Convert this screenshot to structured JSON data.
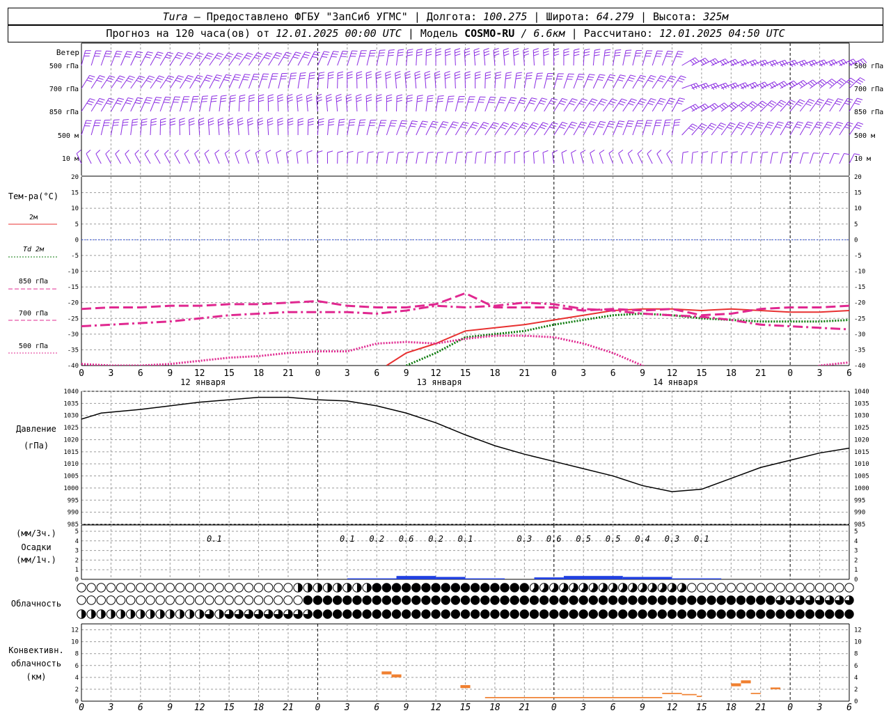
{
  "header": {
    "line1": {
      "station": "Tura",
      "provided_by": "— Предоставлено ФГБУ \"ЗапСиб УГМС\" | Долгота:",
      "lon": "100.275",
      "lat_label": "| Широта:",
      "lat": "64.279",
      "alt_label": "| Высота:",
      "alt": "325м"
    },
    "line2": {
      "forecast": "Прогноз на 120 часа(ов) от",
      "start": "12.01.2025 00:00 UTC",
      "model_label": "| Модель",
      "model": "COSMO-RU",
      "res": "/ 6.6км",
      "calc_label": "| Рассчитано:",
      "calc": "12.01.2025 04:50 UTC"
    }
  },
  "labels": {
    "wind": "Ветер",
    "wind_levels": [
      "500 гПа",
      "700 гПа",
      "850 гПа",
      "500 м",
      "10 м"
    ],
    "temp_title": "Тем-ра(°С)",
    "temp_legend": [
      "2м",
      "Td 2м",
      "850 гПа",
      "700 гПа",
      "500 гПа"
    ],
    "pressure_title": "Давление",
    "pressure_unit": "(гПа)",
    "precip_unit1": "(мм/3ч.)",
    "precip_title": "Осадки",
    "precip_unit2": "(мм/1ч.)",
    "cloud_title": "Облачность",
    "conv_title1": "Конвективн.",
    "conv_title2": "облачность",
    "conv_unit": "(км)"
  },
  "chart_data": [
    {
      "type": "line",
      "title": "Тем-ра(°С)",
      "x_hours": [
        0,
        3,
        6,
        9,
        12,
        15,
        18,
        21,
        24,
        27,
        30,
        33,
        36,
        39,
        42,
        45,
        48,
        51,
        54,
        57,
        60,
        63,
        66,
        69,
        72,
        75,
        78
      ],
      "x_tick_labels": [
        "0",
        "3",
        "6",
        "9",
        "12",
        "15",
        "18",
        "21",
        "0",
        "3",
        "6",
        "9",
        "12",
        "15",
        "18",
        "21",
        "0",
        "3",
        "6",
        "9",
        "12",
        "15",
        "18",
        "21",
        "0",
        "3",
        "6"
      ],
      "day_labels": [
        "12 января",
        "13 января",
        "14 января"
      ],
      "ylim": [
        -40,
        20
      ],
      "yticks": [
        20,
        15,
        10,
        5,
        0,
        -5,
        -10,
        -15,
        -20,
        -25,
        -30,
        -35,
        -40
      ],
      "series": [
        {
          "name": "2м",
          "color": "#e83030",
          "style": "solid",
          "x": [
            31,
            33,
            36,
            39,
            42,
            45,
            48,
            51,
            54,
            57,
            60,
            63,
            66,
            69,
            72,
            75,
            78
          ],
          "y": [
            -40,
            -36,
            -33,
            -29,
            -28,
            -27,
            -25.5,
            -24,
            -22.5,
            -22,
            -22,
            -22.5,
            -22,
            -22.5,
            -23,
            -23,
            -22.5
          ]
        },
        {
          "name": "Td 2м",
          "color": "#0a7a0a",
          "style": "dotted",
          "x": [
            33,
            36,
            39,
            42,
            45,
            48,
            51,
            54,
            57,
            60,
            63,
            66,
            69,
            72,
            75,
            78
          ],
          "y": [
            -40,
            -36,
            -31,
            -30,
            -29,
            -27,
            -25.5,
            -24,
            -23.5,
            -24,
            -25,
            -25.5,
            -26,
            -26,
            -26,
            -25.5
          ]
        },
        {
          "name": "850 гПа",
          "color": "#e02890",
          "style": "dashdot",
          "x": [
            0,
            3,
            6,
            9,
            12,
            15,
            18,
            21,
            24,
            27,
            30,
            33,
            36,
            39,
            42,
            45,
            48,
            51,
            54,
            57,
            60,
            63,
            66,
            69,
            72,
            75,
            78
          ],
          "y": [
            -27.5,
            -27,
            -26.5,
            -26,
            -25,
            -24,
            -23.5,
            -23,
            -23,
            -23,
            -23.5,
            -22.5,
            -21,
            -21.5,
            -21,
            -20,
            -20.5,
            -22,
            -22.5,
            -23.5,
            -24,
            -24.5,
            -25.5,
            -27,
            -27.5,
            -28,
            -28.5
          ]
        },
        {
          "name": "700 гПа",
          "color": "#e02890",
          "style": "dashed",
          "x": [
            0,
            3,
            6,
            9,
            12,
            15,
            18,
            21,
            24,
            27,
            30,
            33,
            36,
            39,
            42,
            45,
            48,
            51,
            54,
            57,
            60,
            63,
            66,
            69,
            72,
            75,
            78
          ],
          "y": [
            -22,
            -21.5,
            -21.5,
            -21,
            -21,
            -20.5,
            -20.5,
            -20,
            -19.5,
            -21,
            -21.5,
            -21.5,
            -20.5,
            -17,
            -21.5,
            -21.5,
            -21.5,
            -22.5,
            -22,
            -22.5,
            -22,
            -24,
            -23.5,
            -22,
            -21.5,
            -21.5,
            -21
          ]
        },
        {
          "name": "500 гПа",
          "color": "#e02890",
          "style": "dotted",
          "x": [
            0,
            3,
            6,
            9,
            12,
            15,
            18,
            21,
            24,
            27,
            30,
            33,
            36,
            39,
            42,
            45,
            48,
            51,
            54,
            57,
            60,
            72,
            75,
            78
          ],
          "y": [
            -39.5,
            -40,
            -40,
            -39.5,
            -38.5,
            -37.5,
            -37,
            -36,
            -35.5,
            -35.5,
            -33,
            -32.5,
            -33,
            -31.5,
            -30.5,
            -30.5,
            -31,
            -33,
            -36,
            -40,
            -45,
            -45,
            -40,
            -39
          ]
        }
      ],
      "zero_line_color": "#3050e0"
    },
    {
      "type": "line",
      "title": "Давление",
      "ylabel": "(гПа)",
      "ylim": [
        985,
        1040
      ],
      "yticks": [
        1040,
        1035,
        1030,
        1025,
        1020,
        1015,
        1010,
        1005,
        1000,
        995,
        990,
        985
      ],
      "series": [
        {
          "name": "Давление",
          "color": "#000000",
          "x": [
            0,
            2,
            6,
            9,
            12,
            15,
            18,
            21,
            24,
            27,
            30,
            33,
            36,
            39,
            42,
            45,
            48,
            51,
            54,
            57,
            60,
            63,
            66,
            69,
            72,
            75,
            78
          ],
          "y": [
            1028.5,
            1031,
            1032.5,
            1034,
            1035.5,
            1036.5,
            1037.5,
            1037.5,
            1036.5,
            1036,
            1034,
            1031,
            1027,
            1022,
            1017.5,
            1014,
            1011,
            1008,
            1005,
            1001,
            998.5,
            999.5,
            1004,
            1008.5,
            1011.5,
            1014.5,
            1016.5
          ]
        }
      ]
    },
    {
      "type": "bar",
      "title": "Осадки",
      "ylim": [
        0,
        5
      ],
      "yticks": [
        5,
        4,
        3,
        2,
        1,
        0
      ],
      "mm3h_x_hours": [
        13.5,
        27,
        30,
        33,
        36,
        39,
        42,
        45,
        48,
        51,
        54,
        57,
        60,
        63,
        66
      ],
      "mm3h_labels": [
        "0.1",
        "0.1",
        "0.2",
        "0.6",
        "0.2",
        "0.1",
        "",
        "0.3",
        "0.6",
        "0.5",
        "0.5",
        "0.4",
        "0.3",
        "0.1",
        ""
      ],
      "mm1h_bars_x": [
        [
          27,
          32
        ],
        [
          32,
          36
        ],
        [
          36,
          39
        ],
        [
          39,
          43
        ],
        [
          46,
          49
        ],
        [
          49,
          55
        ],
        [
          55,
          60
        ],
        [
          60,
          65
        ]
      ],
      "mm1h_bars_y": [
        0.1,
        0.35,
        0.25,
        0.1,
        0.2,
        0.35,
        0.25,
        0.1
      ],
      "color": "#2040e0"
    },
    {
      "type": "bar",
      "title": "Конвективн. облачность",
      "ylabel": "(км)",
      "ylim": [
        0,
        13
      ],
      "yticks": [
        12,
        10,
        8,
        6,
        4,
        2,
        0
      ],
      "segments_x": [
        [
          30.5,
          31.5
        ],
        [
          31.5,
          32.5
        ],
        [
          38.5,
          39.5
        ],
        [
          41,
          59
        ],
        [
          59,
          61
        ],
        [
          61,
          62.5
        ],
        [
          62.5,
          63
        ],
        [
          66,
          67
        ],
        [
          67,
          68
        ],
        [
          68,
          69
        ],
        [
          70,
          71
        ]
      ],
      "segments_y_bottom": [
        4.5,
        4,
        2.2,
        0.5,
        1.2,
        1,
        0.7,
        2.5,
        3,
        1.2,
        2
      ],
      "segments_y_top": [
        5,
        4.5,
        2.7,
        0.7,
        1.4,
        1.2,
        0.9,
        3,
        3.5,
        1.4,
        2.3
      ],
      "color": "#f08030"
    }
  ],
  "colors": {
    "wind_barb": "#8a2be2",
    "grid": "#9a9a9a",
    "text": "#000000"
  }
}
